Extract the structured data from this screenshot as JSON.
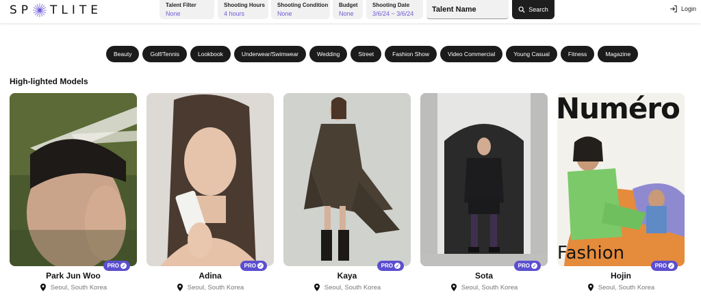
{
  "header": {
    "logo_text": "SP✦TLITE",
    "logo_left": "SP",
    "logo_right": "TLITE",
    "filters": [
      {
        "label": "Talent Filter",
        "value": "None"
      },
      {
        "label": "Shooting Hours",
        "value": "4 hours"
      },
      {
        "label": "Shooting Condition",
        "value": "None"
      },
      {
        "label": "Budget",
        "value": "None"
      },
      {
        "label": "Shooting Date",
        "value": "3/6/24 ~ 3/6/24"
      }
    ],
    "talent_placeholder": "Talent Name",
    "search_label": "Search",
    "login_label": "Login"
  },
  "categories": [
    "Beauty",
    "Golf/Tennis",
    "Lookbook",
    "Underwear/Swimwear",
    "Wedding",
    "Street",
    "Fashion Show",
    "Video Commercial",
    "Young Casual",
    "Fitness",
    "Magazine"
  ],
  "section_title": "High-lighted Models",
  "models": [
    {
      "name": "Park Jun Woo",
      "location": "Seoul, South Korea",
      "badge": "PRO"
    },
    {
      "name": "Adina",
      "location": "Seoul, South Korea",
      "badge": "PRO"
    },
    {
      "name": "Kaya",
      "location": "Seoul, South Korea",
      "badge": "PRO"
    },
    {
      "name": "Sota",
      "location": "Seoul, South Korea",
      "badge": "PRO"
    },
    {
      "name": "Hojin",
      "location": "Seoul, South Korea",
      "badge": "PRO",
      "cover_text_top": "Numéro",
      "cover_text_bottom": "Fashion"
    }
  ],
  "colors": {
    "accent": "#6f5ad6",
    "badge": "#5b4fd0",
    "chip": "#1b1b1b"
  }
}
